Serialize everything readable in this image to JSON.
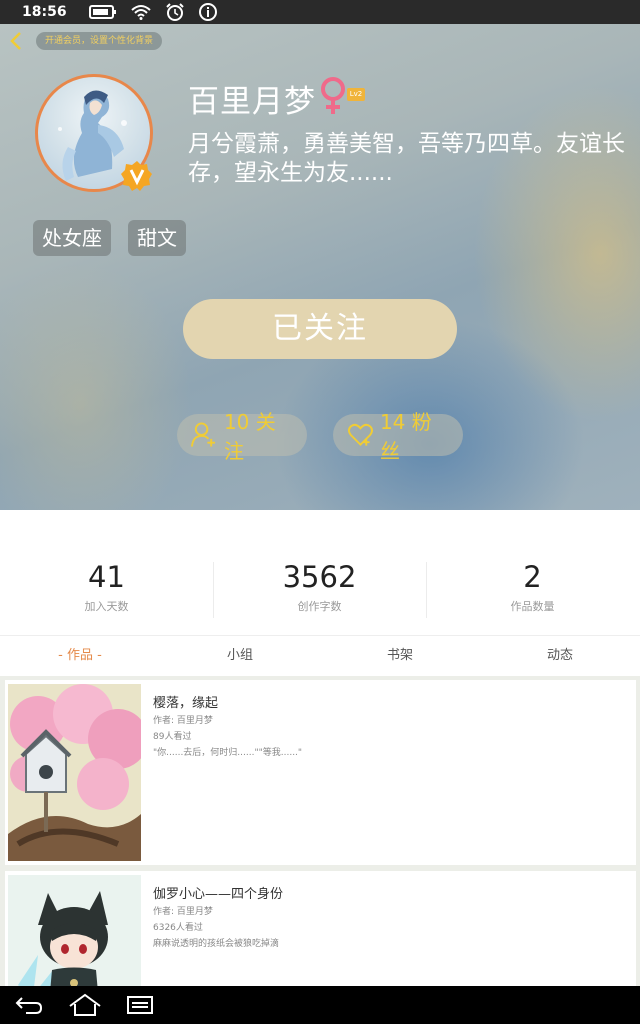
{
  "status_bar": {
    "time": "18:56"
  },
  "header": {
    "vip_prompt": "开通会员，设置个性化背景",
    "user_name": "百里月梦",
    "level": "Lv2",
    "bio": "月兮霞萧，勇善美智，吾等乃四草。友谊长存，望永生为友......",
    "tags": [
      "处女座",
      "甜文"
    ],
    "follow_button_label": "已关注",
    "following_label": "10 关注",
    "fans_label": "14 粉丝"
  },
  "stats": [
    {
      "value": "41",
      "label": "加入天数"
    },
    {
      "value": "3562",
      "label": "创作字数"
    },
    {
      "value": "2",
      "label": "作品数量"
    }
  ],
  "tabs": [
    "- 作品 -",
    "小组",
    "书架",
    "动态"
  ],
  "works": [
    {
      "title": "樱落，缘起",
      "author": "作者: 百里月梦",
      "views": "89人看过",
      "excerpt": "\"你......去后，何时归......\"\"等我......\""
    },
    {
      "title": "伽罗小心——四个身份",
      "author": "作者: 百里月梦",
      "views": "6326人看过",
      "excerpt": "麻麻说透明的孩纸会被狼吃掉滴"
    }
  ],
  "colors": {
    "accent": "#e58a4a",
    "gold": "#f0cc35",
    "follow_button": "#e3d5b0"
  }
}
